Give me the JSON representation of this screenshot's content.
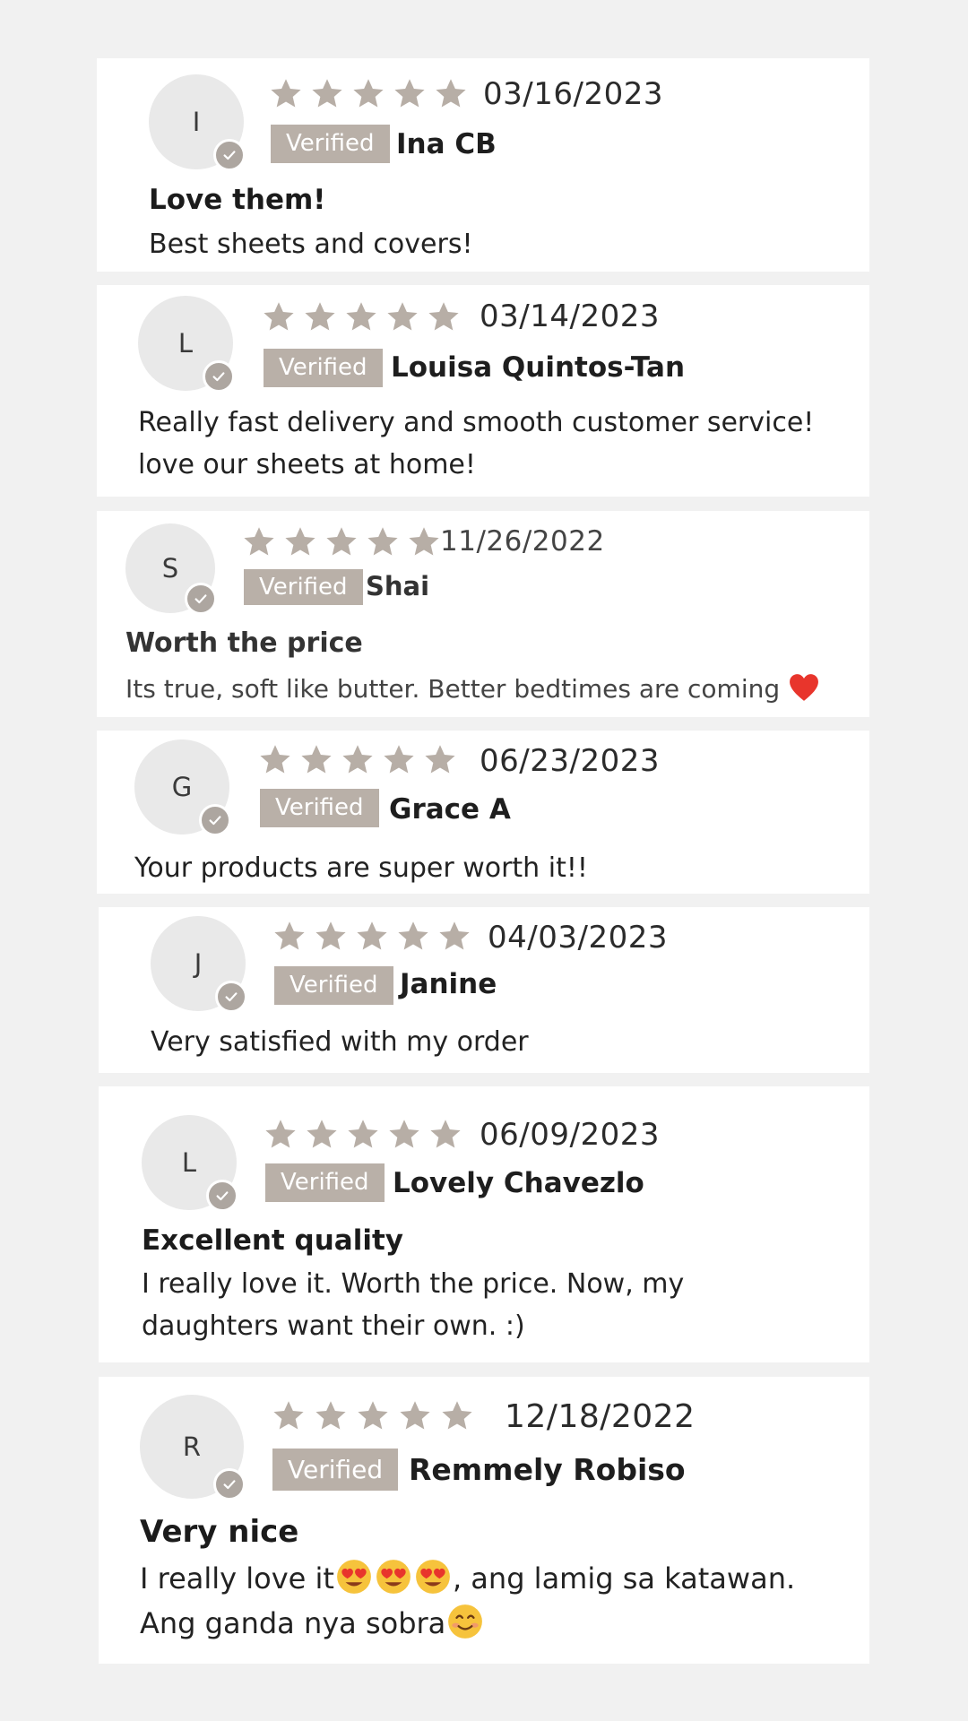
{
  "verified_label": "Verified",
  "colors": {
    "star": "#b7aea6",
    "badge": "#b9b0a8",
    "card": "#ffffff",
    "background": "#f1f1f1",
    "heart": "#e8352c"
  },
  "reviews": [
    {
      "initial": "I",
      "rating": 5,
      "date": "03/16/2023",
      "name": "Ina CB",
      "title": "Love them!",
      "body": [
        "Best sheets and covers!"
      ]
    },
    {
      "initial": "L",
      "rating": 5,
      "date": "03/14/2023",
      "name": "Louisa Quintos-Tan",
      "title": "",
      "body": [
        "Really fast delivery and smooth customer service!",
        "love our sheets at home!"
      ]
    },
    {
      "initial": "S",
      "rating": 5,
      "date": "11/26/2022",
      "name": "Shai",
      "title": "Worth the price",
      "body": [
        "Its true, soft like butter. Better bedtimes are coming"
      ],
      "body_icon": "red-heart-icon"
    },
    {
      "initial": "G",
      "rating": 5,
      "date": "06/23/2023",
      "name": "Grace A",
      "title": "",
      "body": [
        "Your products are super worth it!!"
      ]
    },
    {
      "initial": "J",
      "rating": 5,
      "date": "04/03/2023",
      "name": "Janine",
      "title": "",
      "body": [
        "Very satisfied with my order"
      ]
    },
    {
      "initial": "L",
      "rating": 5,
      "date": "06/09/2023",
      "name": "Lovely Chavezlo",
      "title": "Excellent quality",
      "body": [
        "I really love it. Worth the price. Now, my",
        "daughters want their own. :)"
      ]
    },
    {
      "initial": "R",
      "rating": 5,
      "date": "12/18/2022",
      "name": "Remmely Robiso",
      "title": "Very nice",
      "body": [
        "I really love it",
        ", ang lamig sa katawan.",
        "Ang ganda nya sobra"
      ],
      "body_icons": [
        "heart-eyes-emoji-icon",
        "smiling-face-emoji-icon"
      ]
    }
  ]
}
